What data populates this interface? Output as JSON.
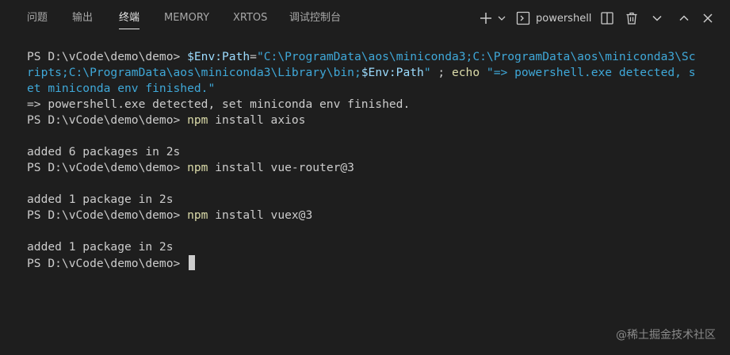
{
  "tabs": {
    "problems": "问题",
    "output": "输出",
    "terminal": "终端",
    "memory": "MEMORY",
    "xrtos": "XRTOS",
    "debug_console": "调试控制台",
    "active": "终端"
  },
  "toolbar": {
    "add_icon": "plus-icon",
    "dropdown_icon": "chevron-down-icon",
    "shell_icon": "terminal-icon",
    "shell_label": "powershell",
    "split_icon": "split-icon",
    "kill_icon": "trash-icon",
    "more_icon": "chevron-down-icon",
    "maximize_icon": "chevron-up-icon",
    "close_icon": "close-icon"
  },
  "colors": {
    "background": "#1e1e1e",
    "text": "#cccccc",
    "variable": "#9cdcfe",
    "string": "#3fa8d8",
    "command": "#dcdcaa"
  },
  "terminal": {
    "line1": {
      "prompt": "PS D:\\vCode\\demo\\demo> ",
      "var1": "$Env:Path",
      "eq": "=",
      "str_a": "\"C:\\ProgramData\\aos\\miniconda3;C:\\ProgramData\\aos\\miniconda3\\Sc"
    },
    "line2": {
      "str_b": "ripts;C:\\ProgramData\\aos\\miniconda3\\Library\\bin;",
      "var2": "$Env:Path",
      "str_c": "\"",
      "sep": " ; ",
      "echo": "echo",
      "str_d": " \"=> powershell.exe detected, s"
    },
    "line3": {
      "str_e": "et miniconda env finished.\""
    },
    "line4": "=> powershell.exe detected, set miniconda env finished.",
    "line5": {
      "prompt": "PS D:\\vCode\\demo\\demo> ",
      "cmd": "npm",
      "args": " install axios"
    },
    "line6": "",
    "line7": "added 6 packages in 2s",
    "line8": {
      "prompt": "PS D:\\vCode\\demo\\demo> ",
      "cmd": "npm",
      "args": " install vue-router@3"
    },
    "line9": "",
    "line10": "added 1 package in 2s",
    "line11": {
      "prompt": "PS D:\\vCode\\demo\\demo> ",
      "cmd": "npm",
      "args": " install vuex@3"
    },
    "line12": "",
    "line13": "added 1 package in 2s",
    "line14": {
      "prompt": "PS D:\\vCode\\demo\\demo>"
    }
  },
  "watermark": "@稀土掘金技术社区"
}
